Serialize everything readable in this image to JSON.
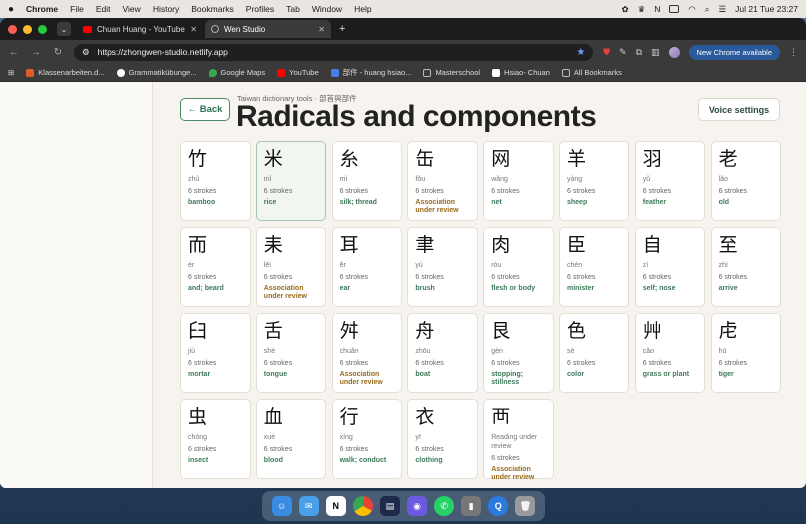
{
  "menubar": {
    "app": "Chrome",
    "items": [
      "File",
      "Edit",
      "View",
      "History",
      "Bookmarks",
      "Profiles",
      "Tab",
      "Window",
      "Help"
    ],
    "clock": "Jul 21 Tue  23:27"
  },
  "tabs": [
    {
      "title": "Chuan Huang - YouTube",
      "icon": "youtube-icon"
    },
    {
      "title": "Wen Studio",
      "icon": "globe-icon"
    }
  ],
  "toolbar": {
    "url": "https://zhongwen-studio.netlify.app",
    "update_label": "New Chrome available"
  },
  "bookmarks": {
    "items": [
      "Klassenarbeiten.d...",
      "Grammatikübunge...",
      "Google Maps",
      "YouTube",
      "部件 - huang hsiao...",
      "Masterschool",
      "Hsiao- Chuan"
    ],
    "all_label": "All Bookmarks"
  },
  "page": {
    "back_label": "← Back",
    "breadcrumb": "Taiwan dictionary tools · 部首與部件",
    "title": "Radicals and components",
    "voice_label": "Voice settings"
  },
  "cards": [
    {
      "char": "竹",
      "pinyin": "zhú",
      "strokes": "6 strokes",
      "meaning": "bamboo",
      "review": false
    },
    {
      "char": "米",
      "pinyin": "mǐ",
      "strokes": "6 strokes",
      "meaning": "rice",
      "review": false,
      "selected": true
    },
    {
      "char": "糸",
      "pinyin": "mì",
      "strokes": "6 strokes",
      "meaning": "silk; thread",
      "review": false
    },
    {
      "char": "缶",
      "pinyin": "fǒu",
      "strokes": "6 strokes",
      "meaning": "Association under review",
      "review": true
    },
    {
      "char": "网",
      "pinyin": "wǎng",
      "strokes": "6 strokes",
      "meaning": "net",
      "review": false
    },
    {
      "char": "羊",
      "pinyin": "yáng",
      "strokes": "6 strokes",
      "meaning": "sheep",
      "review": false
    },
    {
      "char": "羽",
      "pinyin": "yǔ",
      "strokes": "6 strokes",
      "meaning": "feather",
      "review": false
    },
    {
      "char": "老",
      "pinyin": "lǎo",
      "strokes": "6 strokes",
      "meaning": "old",
      "review": false
    },
    {
      "char": "而",
      "pinyin": "ér",
      "strokes": "6 strokes",
      "meaning": "and; beard",
      "review": false
    },
    {
      "char": "耒",
      "pinyin": "lěi",
      "strokes": "6 strokes",
      "meaning": "Association under review",
      "review": true
    },
    {
      "char": "耳",
      "pinyin": "ěr",
      "strokes": "6 strokes",
      "meaning": "ear",
      "review": false
    },
    {
      "char": "聿",
      "pinyin": "yù",
      "strokes": "6 strokes",
      "meaning": "brush",
      "review": false
    },
    {
      "char": "肉",
      "pinyin": "ròu",
      "strokes": "6 strokes",
      "meaning": "flesh or body",
      "review": false
    },
    {
      "char": "臣",
      "pinyin": "chén",
      "strokes": "6 strokes",
      "meaning": "minister",
      "review": false
    },
    {
      "char": "自",
      "pinyin": "zì",
      "strokes": "6 strokes",
      "meaning": "self; nose",
      "review": false
    },
    {
      "char": "至",
      "pinyin": "zhì",
      "strokes": "6 strokes",
      "meaning": "arrive",
      "review": false
    },
    {
      "char": "臼",
      "pinyin": "jiù",
      "strokes": "6 strokes",
      "meaning": "mortar",
      "review": false
    },
    {
      "char": "舌",
      "pinyin": "shé",
      "strokes": "6 strokes",
      "meaning": "tongue",
      "review": false
    },
    {
      "char": "舛",
      "pinyin": "chuǎn",
      "strokes": "6 strokes",
      "meaning": "Association under review",
      "review": true
    },
    {
      "char": "舟",
      "pinyin": "zhōu",
      "strokes": "6 strokes",
      "meaning": "boat",
      "review": false
    },
    {
      "char": "艮",
      "pinyin": "gèn",
      "strokes": "6 strokes",
      "meaning": "stopping; stillness",
      "review": false
    },
    {
      "char": "色",
      "pinyin": "sè",
      "strokes": "6 strokes",
      "meaning": "color",
      "review": false
    },
    {
      "char": "艸",
      "pinyin": "cǎo",
      "strokes": "6 strokes",
      "meaning": "grass or plant",
      "review": false
    },
    {
      "char": "虍",
      "pinyin": "hū",
      "strokes": "6 strokes",
      "meaning": "tiger",
      "review": false
    },
    {
      "char": "虫",
      "pinyin": "chóng",
      "strokes": "6 strokes",
      "meaning": "insect",
      "review": false
    },
    {
      "char": "血",
      "pinyin": "xuè",
      "strokes": "6 strokes",
      "meaning": "blood",
      "review": false
    },
    {
      "char": "行",
      "pinyin": "xíng",
      "strokes": "6 strokes",
      "meaning": "walk; conduct",
      "review": false
    },
    {
      "char": "衣",
      "pinyin": "yī",
      "strokes": "6 strokes",
      "meaning": "clothing",
      "review": false
    },
    {
      "char": "襾",
      "pinyin": "Reading under review",
      "strokes": "6 strokes",
      "meaning": "Association under review",
      "review": true
    }
  ],
  "colors": {
    "accent_green": "#3d7a5a",
    "review_amber": "#9a6a1a"
  }
}
